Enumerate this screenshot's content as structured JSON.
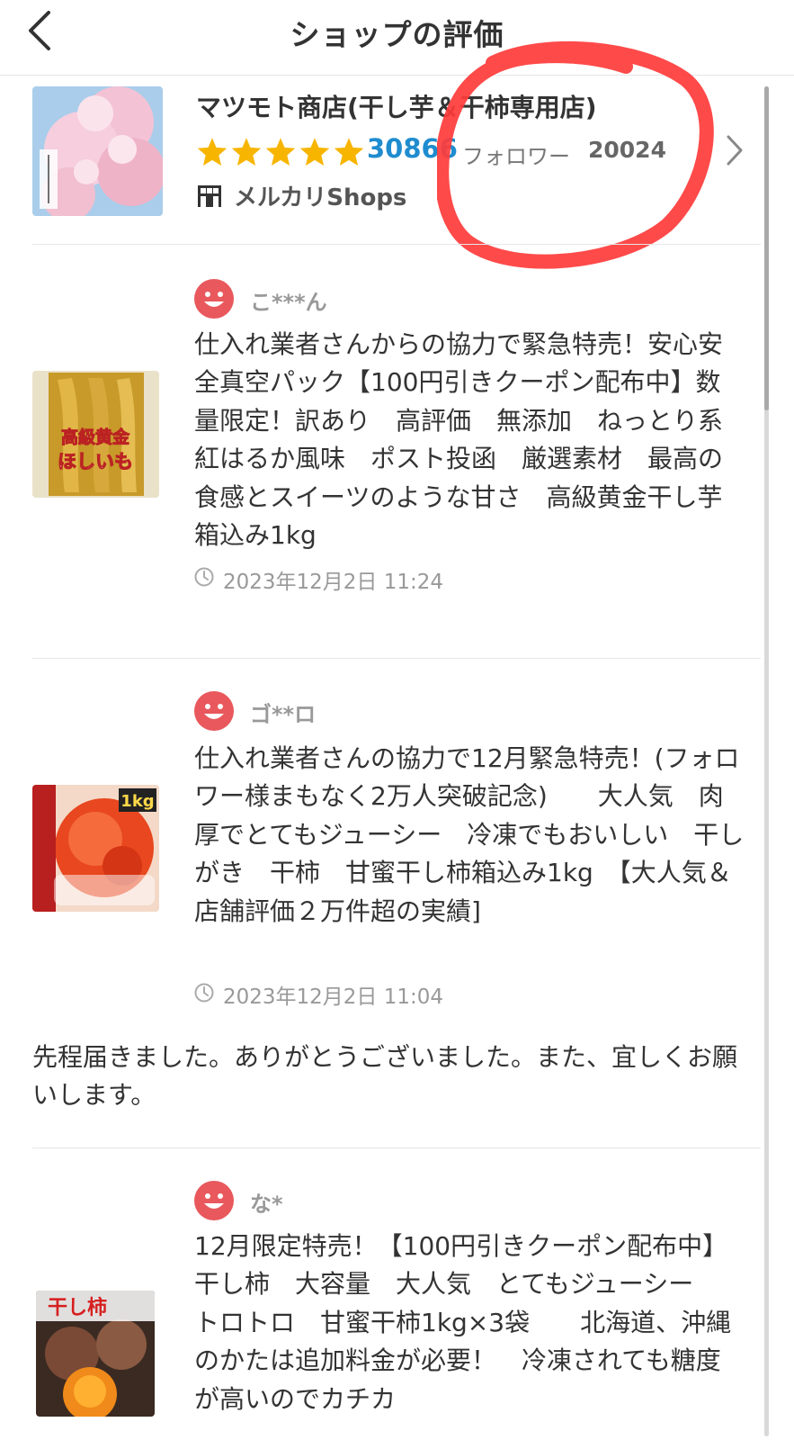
{
  "header": {
    "title": "ショップの評価"
  },
  "shop": {
    "name": "マツモト商店(干し芋＆干柿専用店)",
    "stars": 5,
    "rating_count": "30866",
    "follower_label": "フォロワー",
    "follower_count": "20024",
    "badge_label": "メルカリShops"
  },
  "colors": {
    "star": "#f7b500",
    "link": "#1f8ccf",
    "avatar": "#e8585c",
    "annotation": "#ff3b3b"
  },
  "icons": {
    "back": "chevron-left-icon",
    "forward": "chevron-right-icon",
    "star": "star-icon",
    "shop": "shop-icon",
    "avatar": "smiley-icon",
    "clock": "clock-icon"
  },
  "reviews": [
    {
      "reviewer": "こ***ん",
      "item_title": "仕入れ業者さんからの協力で緊急特売！安心安全真空パック【100円引きクーポン配布中】数量限定！訳あり　高評価　無添加　ねっとり系　紅はるか風味　ポスト投函　厳選素材　最高の食感とスイーツのような甘さ　高級黄金干し芋箱込み1kg",
      "date": "2023年12月2日 11:24",
      "comment": ""
    },
    {
      "reviewer": "ゴ**ロ",
      "item_title": "仕入れ業者さんの協力で12月緊急特売！(フォロワー様まもなく2万人突破記念)　　大人気　肉厚でとてもジューシー　冷凍でもおいしい　干しがき　干柿　甘蜜干し柿箱込み1kg　【大人気＆店舗評価２万件超の実績]",
      "date": "2023年12月2日 11:04",
      "comment": "先程届きました。ありがとうございました。また、宜しくお願いします。"
    },
    {
      "reviewer": "な*",
      "item_title": "12月限定特売！【100円引きクーポン配布中】　干し柿　大容量　大人気　とてもジューシー　　トロトロ　甘蜜干柿1kg×3袋　　北海道、沖縄のかたは追加料金が必要！　冷凍されても糖度が高いのでカチカ",
      "date": "",
      "comment": ""
    }
  ]
}
